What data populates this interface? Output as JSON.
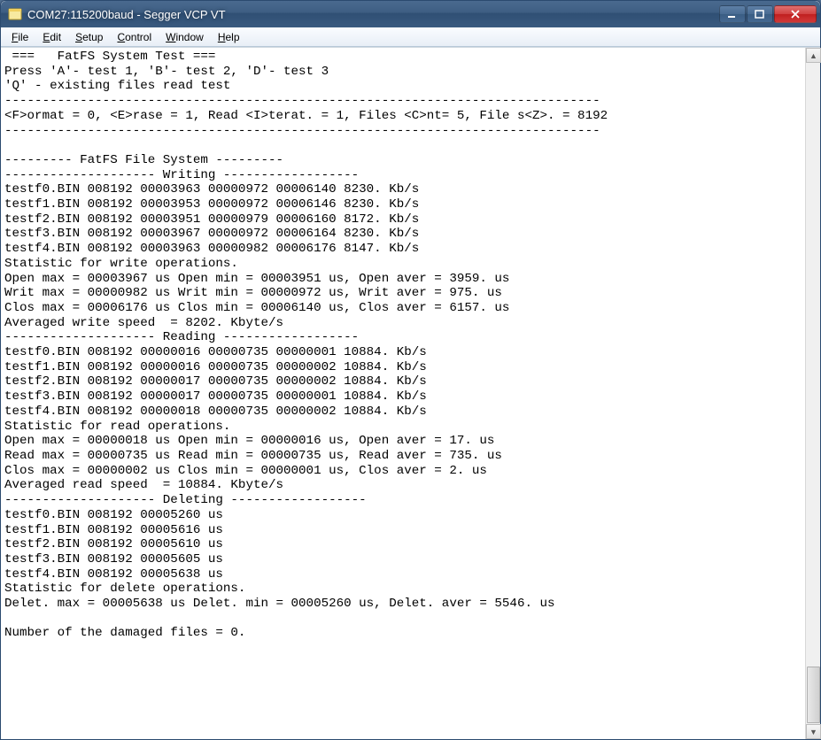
{
  "window": {
    "title": "COM27:115200baud - Segger VCP VT"
  },
  "menu": {
    "file": "File",
    "edit": "Edit",
    "setup": "Setup",
    "control": "Control",
    "window": "Window",
    "help": "Help"
  },
  "terminal": {
    "lines": [
      " ===   FatFS System Test ===",
      "Press 'A'- test 1, 'B'- test 2, 'D'- test 3",
      "'Q' - existing files read test",
      "-------------------------------------------------------------------------------",
      "<F>ormat = 0, <E>rase = 1, Read <I>terat. = 1, Files <C>nt= 5, File s<Z>. = 8192",
      "-------------------------------------------------------------------------------",
      "",
      "--------- FatFS File System ---------",
      "-------------------- Writing ------------------",
      "testf0.BIN 008192 00003963 00000972 00006140 8230. Kb/s",
      "testf1.BIN 008192 00003953 00000972 00006146 8230. Kb/s",
      "testf2.BIN 008192 00003951 00000979 00006160 8172. Kb/s",
      "testf3.BIN 008192 00003967 00000972 00006164 8230. Kb/s",
      "testf4.BIN 008192 00003963 00000982 00006176 8147. Kb/s",
      "Statistic for write operations.",
      "Open max = 00003967 us Open min = 00003951 us, Open aver = 3959. us",
      "Writ max = 00000982 us Writ min = 00000972 us, Writ aver = 975. us",
      "Clos max = 00006176 us Clos min = 00006140 us, Clos aver = 6157. us",
      "Averaged write speed  = 8202. Kbyte/s",
      "-------------------- Reading ------------------",
      "testf0.BIN 008192 00000016 00000735 00000001 10884. Kb/s",
      "testf1.BIN 008192 00000016 00000735 00000002 10884. Kb/s",
      "testf2.BIN 008192 00000017 00000735 00000002 10884. Kb/s",
      "testf3.BIN 008192 00000017 00000735 00000001 10884. Kb/s",
      "testf4.BIN 008192 00000018 00000735 00000002 10884. Kb/s",
      "Statistic for read operations.",
      "Open max = 00000018 us Open min = 00000016 us, Open aver = 17. us",
      "Read max = 00000735 us Read min = 00000735 us, Read aver = 735. us",
      "Clos max = 00000002 us Clos min = 00000001 us, Clos aver = 2. us",
      "Averaged read speed  = 10884. Kbyte/s",
      "-------------------- Deleting ------------------",
      "testf0.BIN 008192 00005260 us",
      "testf1.BIN 008192 00005616 us",
      "testf2.BIN 008192 00005610 us",
      "testf3.BIN 008192 00005605 us",
      "testf4.BIN 008192 00005638 us",
      "Statistic for delete operations.",
      "Delet. max = 00005638 us Delet. min = 00005260 us, Delet. aver = 5546. us",
      "",
      "Number of the damaged files = 0.",
      ""
    ]
  }
}
